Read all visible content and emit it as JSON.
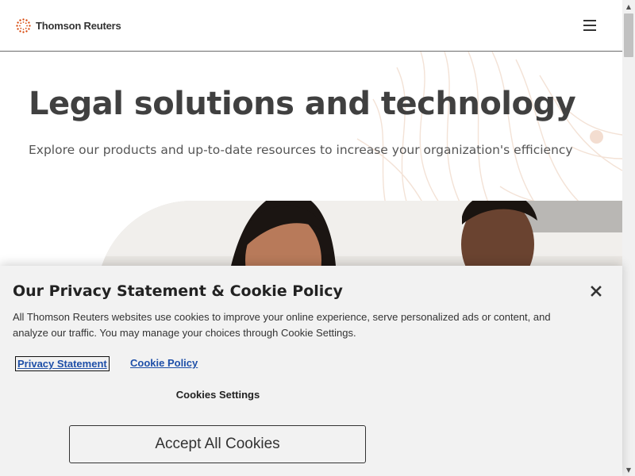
{
  "header": {
    "logo_text": "Thomson Reuters",
    "logo_icon": "thomson-reuters-dot-ring-icon",
    "menu_icon": "hamburger-menu-icon"
  },
  "hero": {
    "title": "Legal solutions and technology",
    "subtitle": "Explore our products and up-to-date resources to increase your organization's efficiency"
  },
  "cookie_banner": {
    "title": "Our Privacy Statement & Cookie Policy",
    "body": "All Thomson Reuters websites use cookies to improve your online experience, serve personalized ads or content, and analyze our traffic. You may manage your choices through Cookie Settings.",
    "privacy_link": "Privacy Statement",
    "cookie_link": "Cookie Policy",
    "settings_label": "Cookies Settings",
    "accept_label": "Accept All Cookies",
    "close_icon": "close-icon"
  },
  "colors": {
    "brand_orange": "#d64000",
    "link_blue": "#1e4fa8",
    "banner_bg": "#f2f2f2",
    "text_dark": "#404040"
  }
}
